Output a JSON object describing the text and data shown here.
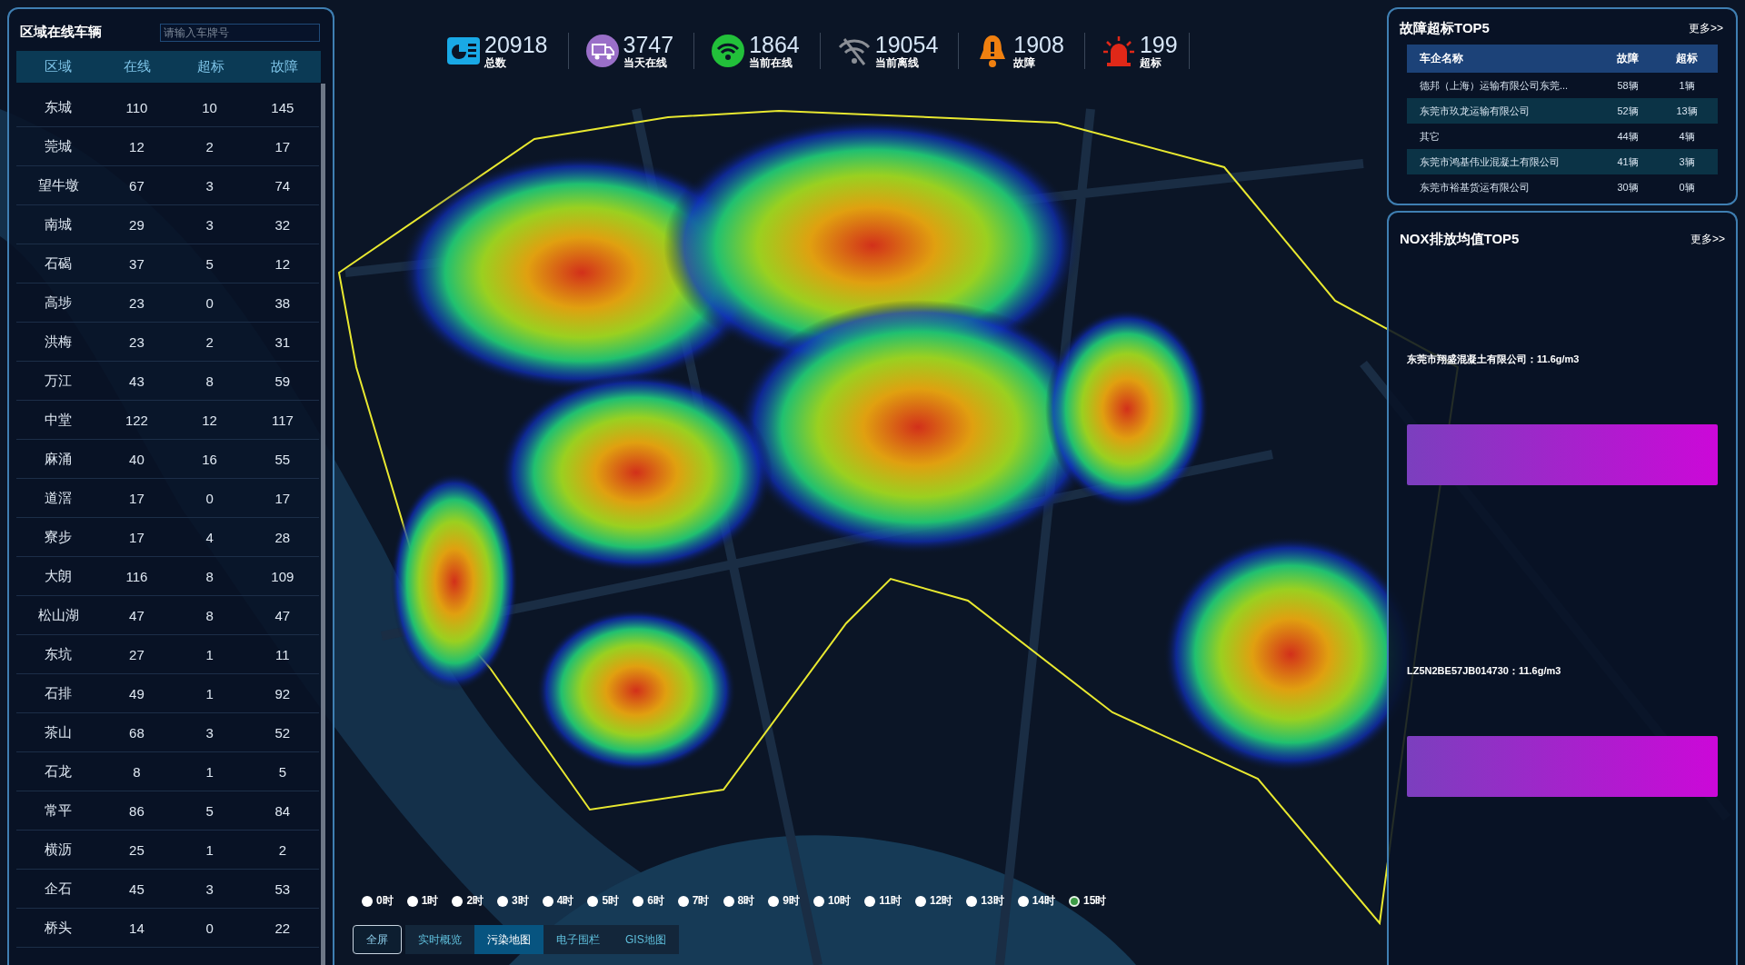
{
  "left_panel": {
    "title": "区域在线车辆",
    "search": {
      "placeholder": "请输入车牌号"
    },
    "columns": [
      "区域",
      "在线",
      "超标",
      "故障"
    ],
    "rows": [
      [
        "东城",
        "110",
        "10",
        "145"
      ],
      [
        "莞城",
        "12",
        "2",
        "17"
      ],
      [
        "望牛墩",
        "67",
        "3",
        "74"
      ],
      [
        "南城",
        "29",
        "3",
        "32"
      ],
      [
        "石碣",
        "37",
        "5",
        "12"
      ],
      [
        "高埗",
        "23",
        "0",
        "38"
      ],
      [
        "洪梅",
        "23",
        "2",
        "31"
      ],
      [
        "万江",
        "43",
        "8",
        "59"
      ],
      [
        "中堂",
        "122",
        "12",
        "117"
      ],
      [
        "麻涌",
        "40",
        "16",
        "55"
      ],
      [
        "道滘",
        "17",
        "0",
        "17"
      ],
      [
        "寮步",
        "17",
        "4",
        "28"
      ],
      [
        "大朗",
        "116",
        "8",
        "109"
      ],
      [
        "松山湖",
        "47",
        "8",
        "47"
      ],
      [
        "东坑",
        "27",
        "1",
        "11"
      ],
      [
        "石排",
        "49",
        "1",
        "92"
      ],
      [
        "茶山",
        "68",
        "3",
        "52"
      ],
      [
        "石龙",
        "8",
        "1",
        "5"
      ],
      [
        "常平",
        "86",
        "5",
        "84"
      ],
      [
        "横沥",
        "25",
        "1",
        "2"
      ],
      [
        "企石",
        "45",
        "3",
        "53"
      ],
      [
        "桥头",
        "14",
        "0",
        "22"
      ]
    ]
  },
  "stats": [
    {
      "kind": "total",
      "value": "20918",
      "label": "总数"
    },
    {
      "kind": "truck",
      "value": "3747",
      "label": "当天在线"
    },
    {
      "kind": "online",
      "value": "1864",
      "label": "当前在线"
    },
    {
      "kind": "offline",
      "value": "19054",
      "label": "当前离线"
    },
    {
      "kind": "fault",
      "value": "1908",
      "label": "故障"
    },
    {
      "kind": "alarm",
      "value": "199",
      "label": "超标"
    }
  ],
  "timeline": [
    {
      "label": "0时",
      "selected": false
    },
    {
      "label": "1时",
      "selected": false
    },
    {
      "label": "2时",
      "selected": false
    },
    {
      "label": "3时",
      "selected": false
    },
    {
      "label": "4时",
      "selected": false
    },
    {
      "label": "5时",
      "selected": false
    },
    {
      "label": "6时",
      "selected": false
    },
    {
      "label": "7时",
      "selected": false
    },
    {
      "label": "8时",
      "selected": false
    },
    {
      "label": "9时",
      "selected": false
    },
    {
      "label": "10时",
      "selected": false
    },
    {
      "label": "11时",
      "selected": false
    },
    {
      "label": "12时",
      "selected": false
    },
    {
      "label": "13时",
      "selected": false
    },
    {
      "label": "14时",
      "selected": false
    },
    {
      "label": "15时",
      "selected": true
    }
  ],
  "fullscreen_button": "全屏",
  "tabs": [
    {
      "label": "实时概览",
      "selected": false
    },
    {
      "label": "污染地图",
      "selected": true
    },
    {
      "label": "电子围栏",
      "selected": false
    },
    {
      "label": "GIS地图",
      "selected": false
    }
  ],
  "fault_top5": {
    "title": "故障超标TOP5",
    "more": "更多>>",
    "columns": [
      "车企名称",
      "故障",
      "超标"
    ],
    "rows": [
      [
        "德邦（上海）运输有限公司东莞...",
        "58辆",
        "1辆"
      ],
      [
        "东莞市玖龙运输有限公司",
        "52辆",
        "13辆"
      ],
      [
        "其它",
        "44辆",
        "4辆"
      ],
      [
        "东莞市鸿基伟业混凝土有限公司",
        "41辆",
        "3辆"
      ],
      [
        "东莞市裕基货运有限公司",
        "30辆",
        "0辆"
      ]
    ]
  },
  "nox_top5": {
    "title": "NOX排放均值TOP5",
    "more": "更多>>",
    "items": [
      {
        "label": "东莞市翔盛混凝土有限公司：11.6g/m3"
      },
      {
        "label": "LZ5N2BE57JB014730：11.6g/m3"
      }
    ]
  }
}
